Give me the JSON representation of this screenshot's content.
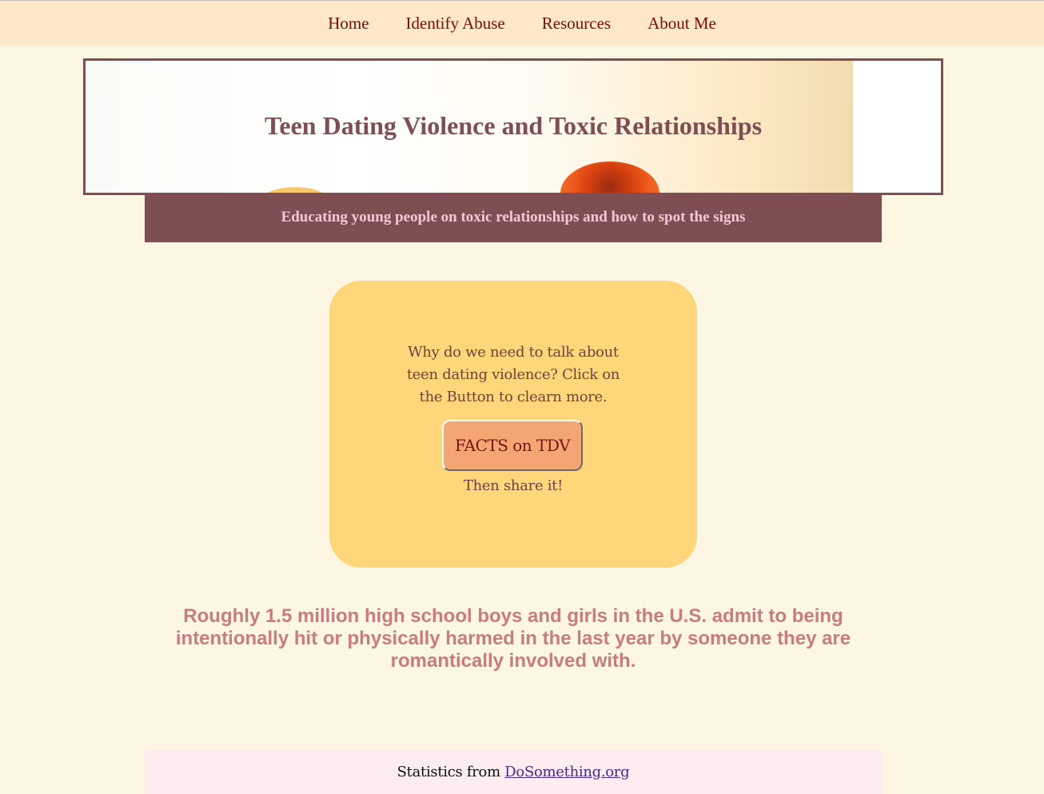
{
  "nav": {
    "items": [
      {
        "label": "Home"
      },
      {
        "label": "Identify Abuse"
      },
      {
        "label": "Resources"
      },
      {
        "label": "About Me"
      }
    ]
  },
  "banner": {
    "title": "Teen Dating Violence and Toxic Relationships"
  },
  "subheader": {
    "text": "Educating young people on toxic relationships and how to spot the signs"
  },
  "card": {
    "prompt": "Why do we need to talk about teen dating violence? Click on the Button to clearn more.",
    "button_label": "FACTS on TDV",
    "share_text": "Then share it!"
  },
  "statistic": {
    "text": "Roughly 1.5 million high school boys and girls in the U.S. admit to being intentionally hit or physically harmed in the last year by someone they are romantically involved with."
  },
  "footer": {
    "prefix": "Statistics from ",
    "link_label": "DoSomething.org"
  },
  "colors": {
    "page_background": "#fdf6e3",
    "nav_background": "#ffe8c8",
    "nav_link": "#7a0c0c",
    "banner_border": "#7e4e55",
    "subheader_background": "#7e4e52",
    "subheader_text": "#f6c6d6",
    "card_background": "#ffd67a",
    "button_background": "#f3a673",
    "statistic_text": "#c87c80",
    "footer_background": "#fdecf0",
    "footer_link": "#4a2a83"
  }
}
